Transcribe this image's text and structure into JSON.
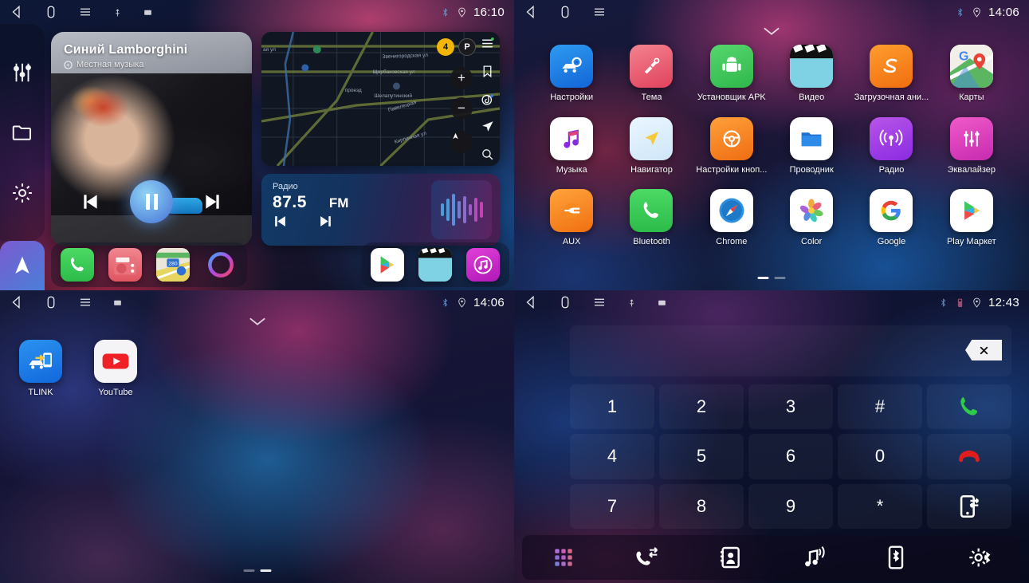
{
  "panel1": {
    "statusbar": {
      "time": "16:10",
      "icons": [
        "back-icon",
        "home-icon",
        "menu-icon",
        "usb-icon",
        "sdcard-icon"
      ],
      "right_icons": [
        "bluetooth-icon",
        "location-icon"
      ]
    },
    "sidebar": {
      "items": [
        {
          "icon": "equalizer-icon",
          "name": "sidebar-item-equalizer"
        },
        {
          "icon": "folder-icon",
          "name": "sidebar-item-files"
        },
        {
          "icon": "gear-icon",
          "name": "sidebar-item-settings"
        }
      ],
      "nav_tile": "navigation-arrow-icon"
    },
    "music": {
      "title": "Синий Lamborghini",
      "subtitle": "Местная музыка",
      "source_icon": "music-source-icon",
      "prev": "previous-track-icon",
      "play_state": "pause-icon",
      "next": "next-track-icon"
    },
    "map": {
      "labels": [
        "Звенигородская ул",
        "Щербаковская ул",
        "Шелапутинский",
        "Павелецкая",
        "Кирпичная ул"
      ],
      "badge": "4",
      "parking": "P",
      "rail_icons": [
        "menu-icon",
        "bookmark-icon",
        "discover-icon",
        "navigate-icon",
        "search-icon"
      ],
      "zoom_in": "+",
      "zoom_out": "−",
      "compass": "compass-icon"
    },
    "radio": {
      "label": "Радио",
      "frequency": "87.5",
      "band": "FM",
      "prev": "previous-station-icon",
      "next": "next-station-icon",
      "visualizer": "audio-wave-icon"
    },
    "dock": [
      {
        "name": "dock-phone",
        "label": "Phone"
      },
      {
        "name": "dock-radio",
        "label": "Radio"
      },
      {
        "name": "dock-maps",
        "label": "Maps"
      },
      {
        "name": "dock-assistant",
        "label": "Assistant"
      },
      {
        "name": "dock-play-store",
        "label": "Play Store"
      },
      {
        "name": "dock-video",
        "label": "Video"
      },
      {
        "name": "dock-music",
        "label": "Music"
      }
    ]
  },
  "panel2": {
    "statusbar": {
      "time": "14:06",
      "icons": [
        "back-icon",
        "home-icon",
        "menu-icon"
      ],
      "right_icons": [
        "bluetooth-icon",
        "location-icon"
      ]
    },
    "chevron": "chevron-down-icon",
    "apps": [
      {
        "label": "Настройки",
        "icon": "car-settings-icon"
      },
      {
        "label": "Тема",
        "icon": "theme-brush-icon"
      },
      {
        "label": "Установщик APK",
        "icon": "android-icon"
      },
      {
        "label": "Видео",
        "icon": "video-clapper-icon"
      },
      {
        "label": "Загрузочная ани...",
        "icon": "boot-animation-icon"
      },
      {
        "label": "Карты",
        "icon": "google-maps-icon"
      },
      {
        "label": "Музыка",
        "icon": "music-note-icon"
      },
      {
        "label": "Навигатор",
        "icon": "navigator-arrow-icon"
      },
      {
        "label": "Настройки кноп...",
        "icon": "steering-wheel-icon"
      },
      {
        "label": "Проводник",
        "icon": "file-manager-icon"
      },
      {
        "label": "Радио",
        "icon": "radio-broadcast-icon"
      },
      {
        "label": "Эквалайзер",
        "icon": "equalizer-sliders-icon"
      },
      {
        "label": "AUX",
        "icon": "aux-plug-icon"
      },
      {
        "label": "Bluetooth",
        "icon": "phone-handset-icon"
      },
      {
        "label": "Chrome",
        "icon": "safari-compass-icon"
      },
      {
        "label": "Color",
        "icon": "color-flower-icon"
      },
      {
        "label": "Google",
        "icon": "google-g-icon"
      },
      {
        "label": "Play Маркет",
        "icon": "play-store-icon"
      }
    ],
    "pages": {
      "count": 2,
      "active": 1
    }
  },
  "panel3": {
    "statusbar": {
      "time": "14:06",
      "icons": [
        "back-icon",
        "home-icon",
        "menu-icon",
        "sdcard-icon"
      ],
      "right_icons": [
        "bluetooth-icon",
        "location-icon"
      ]
    },
    "chevron": "chevron-down-icon",
    "apps": [
      {
        "label": "TLINK",
        "icon": "tlink-carplay-icon"
      },
      {
        "label": "YouTube",
        "icon": "youtube-icon"
      }
    ],
    "pages": {
      "count": 2,
      "active": 2
    }
  },
  "panel4": {
    "statusbar": {
      "time": "12:43",
      "icons": [
        "back-icon",
        "home-icon",
        "menu-icon",
        "usb-icon",
        "sdcard-icon"
      ],
      "right_icons": [
        "bluetooth-icon",
        "battery-icon",
        "location-icon"
      ]
    },
    "display_value": "",
    "backspace": "backspace-icon",
    "keys": [
      {
        "label": "1",
        "name": "key-1"
      },
      {
        "label": "2",
        "name": "key-2"
      },
      {
        "label": "3",
        "name": "key-3"
      },
      {
        "label": "#",
        "name": "key-hash"
      },
      {
        "label": "",
        "name": "call-button",
        "icon": "call-green-icon"
      },
      {
        "label": "4",
        "name": "key-4"
      },
      {
        "label": "5",
        "name": "key-5"
      },
      {
        "label": "6",
        "name": "key-6"
      },
      {
        "label": "0",
        "name": "key-0"
      },
      {
        "label": "",
        "name": "hangup-button",
        "icon": "hangup-red-icon"
      },
      {
        "label": "7",
        "name": "key-7"
      },
      {
        "label": "8",
        "name": "key-8"
      },
      {
        "label": "9",
        "name": "key-9"
      },
      {
        "label": "*",
        "name": "key-star"
      },
      {
        "label": "",
        "name": "transfer-button",
        "icon": "transfer-call-icon"
      }
    ],
    "bottom_bar": [
      {
        "name": "tab-keypad",
        "icon": "keypad-grid-icon"
      },
      {
        "name": "tab-call-log",
        "icon": "call-log-icon"
      },
      {
        "name": "tab-contacts",
        "icon": "contacts-book-icon"
      },
      {
        "name": "tab-music",
        "icon": "music-stream-icon"
      },
      {
        "name": "tab-phone-link",
        "icon": "phone-bluetooth-icon"
      },
      {
        "name": "tab-bt-settings",
        "icon": "bluetooth-settings-icon"
      }
    ]
  },
  "colors": {
    "accent_blue": "#5b8fe0",
    "green": "#3ec75a",
    "red": "#e02020",
    "magenta": "#c0399a"
  }
}
